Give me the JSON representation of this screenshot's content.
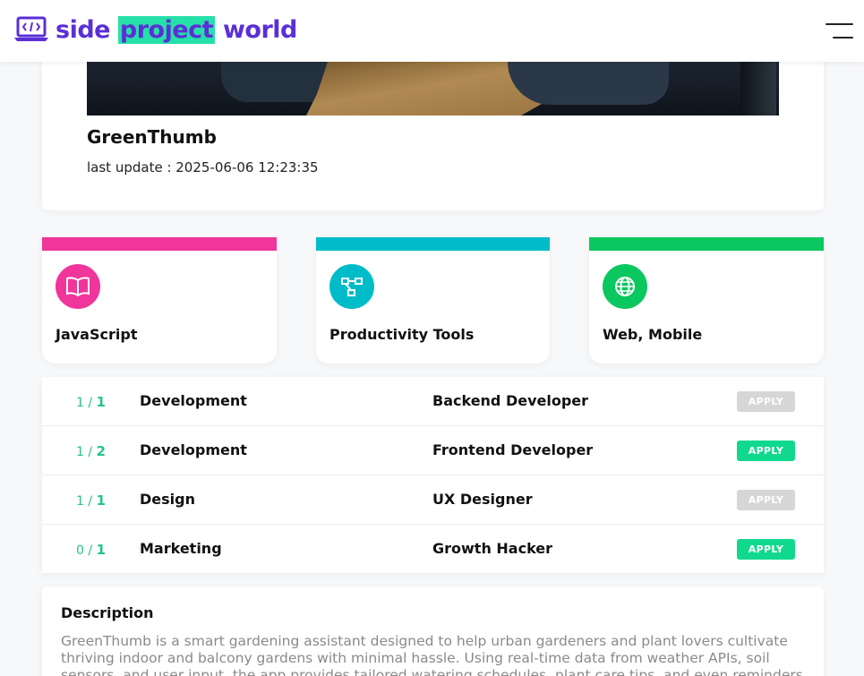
{
  "brand": {
    "word1": "side",
    "word2": "project",
    "word3": "world",
    "color": "#5b2fd6",
    "highlight": "#25e0a8"
  },
  "header": {
    "menu_icon": "hamburger-menu-icon"
  },
  "project": {
    "title": "GreenThumb",
    "last_update": "last update : 2025-06-06 12:23:35"
  },
  "categories": [
    {
      "label": "JavaScript",
      "icon": "book-icon",
      "color": "#f0359b"
    },
    {
      "label": "Productivity Tools",
      "icon": "workflow-icon",
      "color": "#00bcc8"
    },
    {
      "label": "Web, Mobile",
      "icon": "globe-icon",
      "color": "#0bc75f"
    }
  ],
  "roles": [
    {
      "filled": "1",
      "total": "1",
      "category": "Development",
      "position": "Backend Developer",
      "apply": "APPLY",
      "open": false
    },
    {
      "filled": "1",
      "total": "2",
      "category": "Development",
      "position": "Frontend Developer",
      "apply": "APPLY",
      "open": true
    },
    {
      "filled": "1",
      "total": "1",
      "category": "Design",
      "position": "UX Designer",
      "apply": "APPLY",
      "open": false
    },
    {
      "filled": "0",
      "total": "1",
      "category": "Marketing",
      "position": "Growth Hacker",
      "apply": "APPLY",
      "open": true
    }
  ],
  "description": {
    "title": "Description",
    "body": "GreenThumb is a smart gardening assistant designed to help urban gardeners and plant lovers cultivate thriving indoor and balcony gardens with minimal hassle. Using real-time data from weather APIs, soil sensors, and user input, the app provides tailored watering schedules, plant care tips, and even reminders"
  }
}
